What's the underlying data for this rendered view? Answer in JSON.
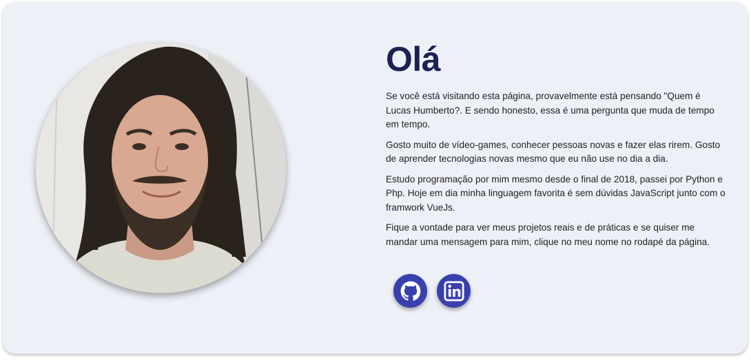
{
  "profile": {
    "photo_alt": "Lucas Humberto"
  },
  "about": {
    "title": "Olá",
    "paragraphs": [
      "Se você está visitando esta página, provavelmente está pensando \"Quem é Lucas Humberto?. E sendo honesto, essa é uma pergunta que muda de tempo em tempo.",
      "Gosto muito de vídeo-games, conhecer pessoas novas e fazer elas rirem. Gosto de aprender tecnologias novas mesmo que eu não use no dia a dia.",
      "Estudo programação por mim mesmo desde o final de 2018, passei por Python e Php. Hoje em dia minha linguagem favorita é sem dúvidas JavaScript junto com o framwork VueJs.",
      "Fique a vontade para ver meus projetos reais e de práticas e se quiser me mandar uma mensagem para mim, clique no meu nome no rodapé da página."
    ]
  },
  "socials": [
    {
      "icon": "github-icon"
    },
    {
      "icon": "linkedin-icon"
    }
  ],
  "colors": {
    "card_background": "#eef0f8",
    "title": "#1c2152",
    "social_button": "#3a3fae"
  }
}
